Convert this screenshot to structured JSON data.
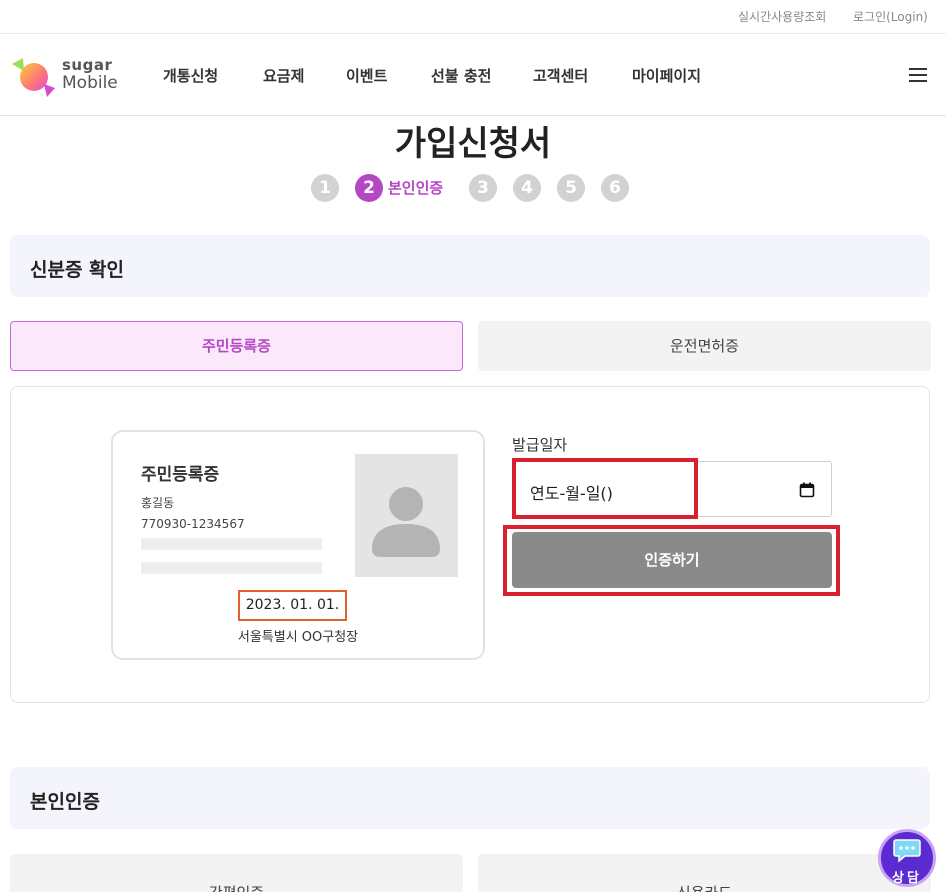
{
  "utility": {
    "usage_link": "실시간사용량조회",
    "login_link": "로그인(Login)"
  },
  "brand": {
    "line1": "sugar",
    "line2": "Mobile"
  },
  "nav": {
    "items": [
      "개통신청",
      "요금제",
      "이벤트",
      "선불 충전",
      "고객센터",
      "마이페이지"
    ]
  },
  "page": {
    "title": "가입신청서"
  },
  "steps": {
    "numbers": [
      "1",
      "2",
      "3",
      "4",
      "5",
      "6"
    ],
    "active_label": "본인인증"
  },
  "id_section": {
    "header": "신분증 확인",
    "tabs": [
      "주민등록증",
      "운전면허증"
    ],
    "card": {
      "title": "주민등록증",
      "name": "홍길동",
      "rrn": "770930-1234567",
      "issue_date": "2023. 01. 01.",
      "issuer": "서울특별시 OO구청장"
    },
    "form": {
      "issue_label": "발급일자",
      "date_placeholder": "연도-월-일()",
      "verify_button": "인증하기"
    }
  },
  "auth_section": {
    "header": "본인인증",
    "options": [
      "간편인증",
      "신용카드"
    ]
  },
  "chat": {
    "label": "상담"
  },
  "colors": {
    "accent": "#b547c4",
    "highlight": "#d9202e",
    "button_gray": "#8a8a8a",
    "section_bg": "#f4f4fc"
  }
}
